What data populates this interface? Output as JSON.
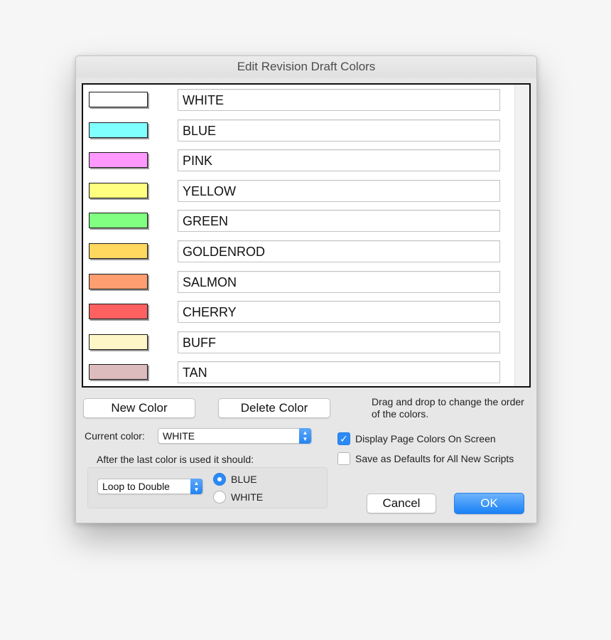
{
  "dialog": {
    "title": "Edit Revision Draft Colors"
  },
  "colors": [
    {
      "name": "WHITE",
      "swatch": "#ffffff"
    },
    {
      "name": "BLUE",
      "swatch": "#80ffff"
    },
    {
      "name": "PINK",
      "swatch": "#ff99ff"
    },
    {
      "name": "YELLOW",
      "swatch": "#ffff80"
    },
    {
      "name": "GREEN",
      "swatch": "#80ff80"
    },
    {
      "name": "GOLDENROD",
      "swatch": "#ffd860"
    },
    {
      "name": "SALMON",
      "swatch": "#ff9e70"
    },
    {
      "name": "CHERRY",
      "swatch": "#ff6060"
    },
    {
      "name": "BUFF",
      "swatch": "#fff6c8"
    },
    {
      "name": "TAN",
      "swatch": "#dcbcbc"
    }
  ],
  "buttons": {
    "new_color": "New Color",
    "delete_color": "Delete Color",
    "cancel": "Cancel",
    "ok": "OK"
  },
  "help_text": "Drag and drop to change the order of the colors.",
  "current_color": {
    "label": "Current color:",
    "value": "WHITE"
  },
  "after_last": {
    "label": "After the last color is used it should:",
    "mode": "Loop to Double",
    "options": [
      {
        "label": "BLUE",
        "selected": true
      },
      {
        "label": "WHITE",
        "selected": false
      }
    ]
  },
  "checkboxes": [
    {
      "label": "Display Page Colors On Screen",
      "checked": true
    },
    {
      "label": "Save as Defaults for All New Scripts",
      "checked": false
    }
  ],
  "accent_color": "#1a82f7"
}
